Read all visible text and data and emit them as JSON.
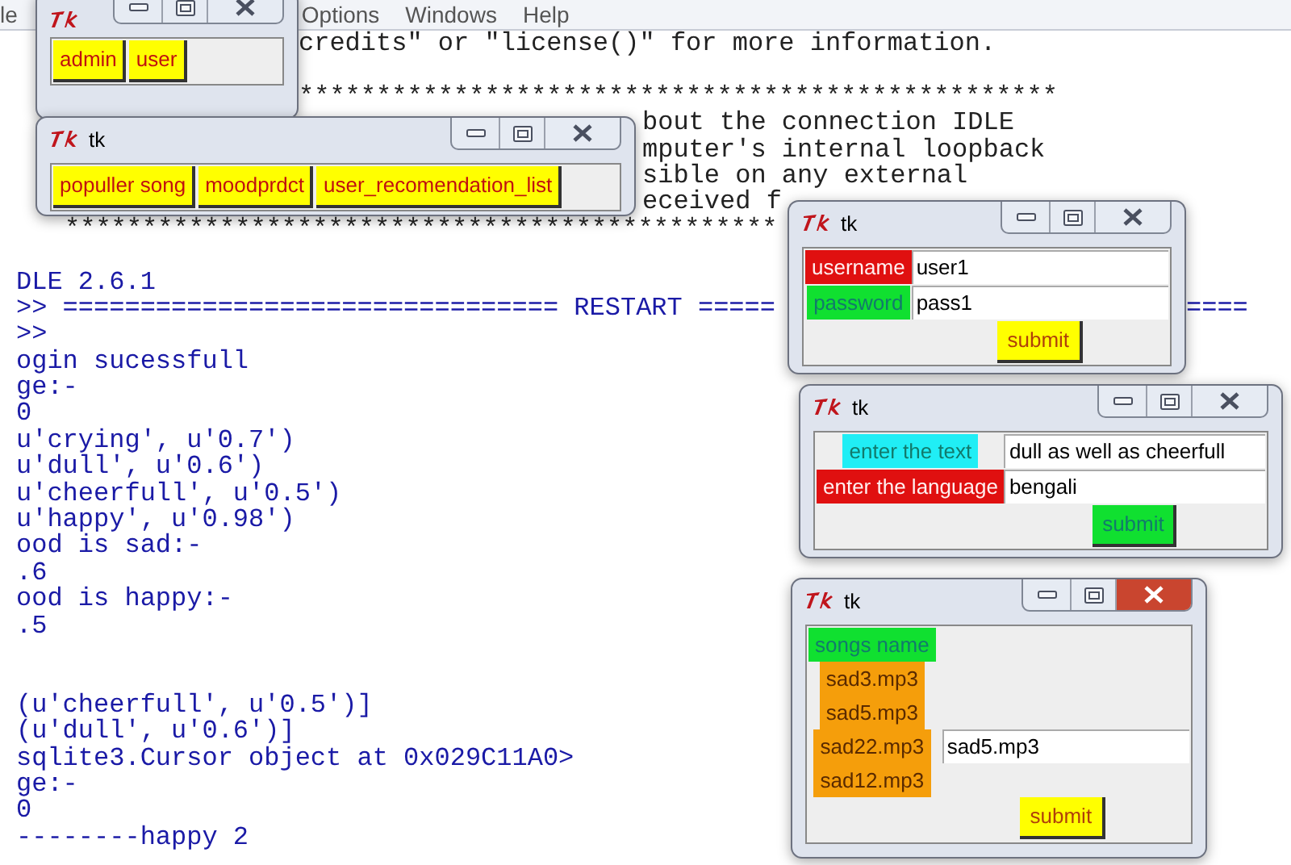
{
  "menu_bar": {
    "items": [
      "le",
      "Options",
      "Windows",
      "Help"
    ]
  },
  "shell": {
    "groups": [
      [
        {
          "text": "credits\" or \"license()\" for more information."
        }
      ],
      [
        {
          "text": "*************************************************"
        },
        {
          "text": "bout the connection IDLE"
        },
        {
          "text": "mputer's internal loopback"
        },
        {
          "text": "sible on any external"
        },
        {
          "text": "eceived f"
        },
        {
          "text": "**********************************************"
        }
      ],
      [
        {
          "text": "DLE 2.6.1"
        },
        {
          "text": ">> ================================ RESTART =====",
          "tail": "===="
        },
        {
          "text": ">>"
        },
        {
          "text": "ogin sucessfull"
        },
        {
          "text": "ge:-"
        },
        {
          "text": "0"
        },
        {
          "text": "u'crying', u'0.7')"
        },
        {
          "text": "u'dull', u'0.6')"
        },
        {
          "text": "u'cheerfull', u'0.5')"
        },
        {
          "text": "u'happy', u'0.98')"
        },
        {
          "text": "ood is sad:-"
        },
        {
          "text": ".6"
        },
        {
          "text": "ood is happy:-"
        },
        {
          "text": ".5"
        }
      ],
      [
        {
          "text": "(u'cheerfull', u'0.5')]"
        },
        {
          "text": "(u'dull', u'0.6')]"
        },
        {
          "text": "sqlite3.Cursor object at 0x029C11A0>"
        },
        {
          "text": "ge:-"
        },
        {
          "text": "0"
        },
        {
          "text": "--------happy 2"
        }
      ]
    ]
  },
  "windows": [
    {
      "kind": "buttons",
      "active": false,
      "buttons": [
        {
          "label": "admin"
        },
        {
          "label": "user"
        }
      ]
    },
    {
      "kind": "buttons",
      "title": "tk",
      "active": false,
      "buttons": [
        {
          "label": "populler song"
        },
        {
          "label": "moodprdct"
        },
        {
          "label": "user_recomendation_list"
        }
      ]
    },
    {
      "kind": "form",
      "title": "tk",
      "active": false,
      "fields": [
        {
          "label": "username",
          "color": "#e01010",
          "value": "user1"
        },
        {
          "label": "password",
          "color": "#10e030",
          "value": "pass1"
        }
      ],
      "submit": {
        "label": "submit",
        "color": "#ffff00"
      }
    },
    {
      "kind": "form",
      "title": "tk",
      "active": false,
      "fields": [
        {
          "label": "enter the text",
          "color": "#20eef5",
          "value": "dull as well as cheerfull"
        },
        {
          "label": "enter the language",
          "color": "#e01010",
          "value": "bengali"
        }
      ],
      "submit": {
        "label": "submit",
        "color": "#10e030"
      }
    },
    {
      "kind": "list",
      "title": "tk",
      "active": true,
      "heading": {
        "label": "songs name",
        "color": "#10e030"
      },
      "items": [
        {
          "label": "sad3.mp3"
        },
        {
          "label": "sad5.mp3"
        },
        {
          "label": "sad22.mp3",
          "entry": "sad5.mp3"
        },
        {
          "label": "sad12.mp3"
        }
      ],
      "submit": {
        "label": "submit",
        "color": "#ffff00"
      }
    }
  ]
}
